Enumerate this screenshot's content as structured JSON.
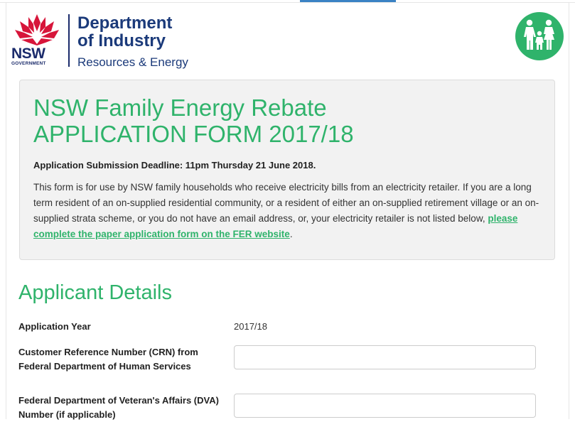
{
  "header": {
    "logo": {
      "nsw_wordmark": "NSW",
      "government_label": "GOVERNMENT",
      "department_line1": "Department",
      "department_line2": "of Industry",
      "department_line3": "Resources & Energy"
    },
    "badge_icon": "family-icon",
    "colors": {
      "brand_green": "#2fb36b",
      "nsw_red": "#d7153a",
      "nsw_navy": "#1b2b6b"
    }
  },
  "intro": {
    "title_line1": "NSW Family Energy Rebate",
    "title_line2": "APPLICATION FORM 2017/18",
    "deadline": "Application Submission Deadline: 11pm Thursday 21 June 2018.",
    "body": "This form is for use by NSW family households who receive electricity bills from an electricity retailer. If you are a long term resident of an on-supplied residential community, or a resident of either an on-supplied retirement village or an on-supplied strata scheme, or you do not have an email address, or, your electricity retailer is not listed below, ",
    "link": "please complete the paper application form on the FER website",
    "body_end": "."
  },
  "applicant": {
    "section_title": "Applicant Details",
    "fields": [
      {
        "label": "Application Year",
        "value": "2017/18"
      },
      {
        "label": "Customer Reference Number (CRN) from Federal Department of Human Services",
        "value": ""
      },
      {
        "label": "Federal Department of Veteran's Affairs (DVA) Number (if applicable)",
        "value": ""
      }
    ]
  }
}
